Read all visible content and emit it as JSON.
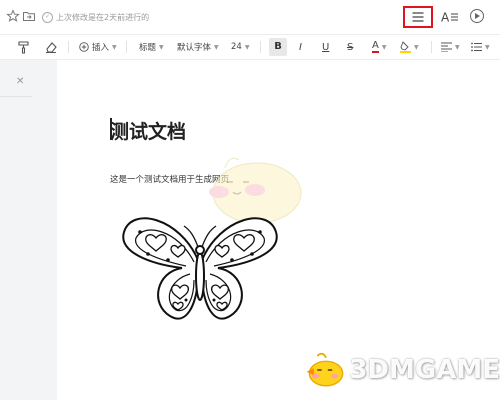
{
  "header": {
    "save_status": "上次修改是在2天前进行的"
  },
  "toolbar": {
    "insert_label": "插入",
    "heading_label": "标题",
    "font_label": "默认字体",
    "size_label": "24",
    "bold": "B",
    "italic": "I",
    "underline": "U",
    "strike": "S",
    "font_color": "A"
  },
  "document": {
    "title": "测试文档",
    "body": "这是一个测试文档用于生成网页"
  },
  "watermark": {
    "text": "3DMGAME"
  },
  "colors": {
    "highlight_border": "#e0141e",
    "font_color_underline": "#e0141e",
    "highlight_color": "#ffd600"
  }
}
